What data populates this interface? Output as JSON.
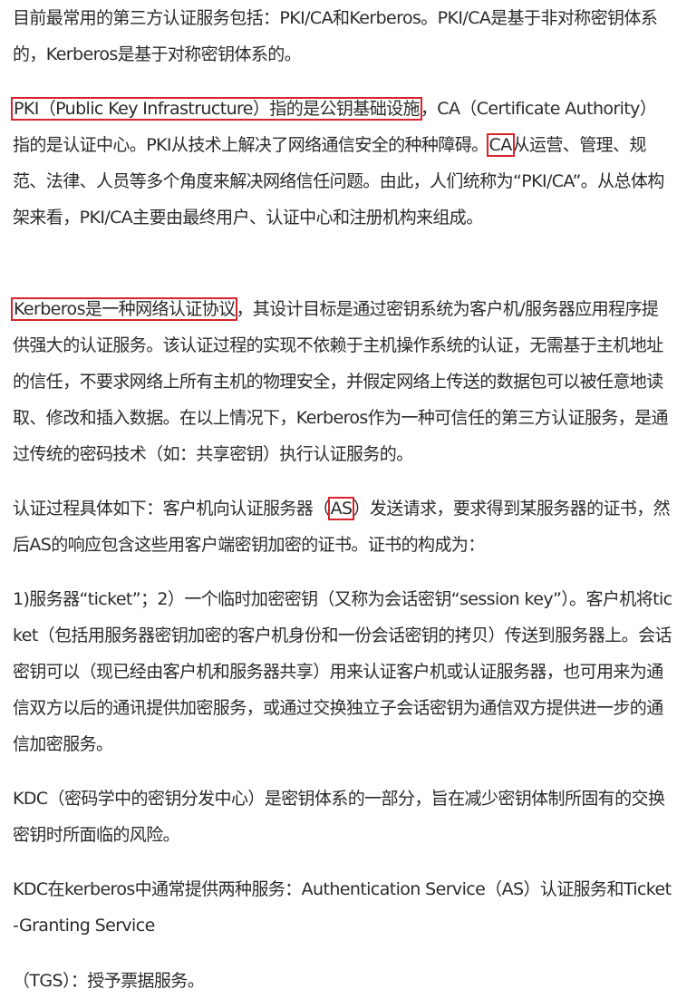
{
  "article": {
    "p1": "目前最常用的第三方认证服务包括：PKI/CA和Kerberos。PKI/CA是基于非对称密钥体系的，Kerberos是基于对称密钥体系的。",
    "p2": {
      "hl1": "PKI（Public Key Infrastructure）指的是公钥基础设施",
      "t1": "，CA（Certificate Authority）指的是认证中心。PKI从技术上解决了网络通信安全的种种障碍。",
      "hl2": "CA",
      "t2": "从运营、管理、规范、法律、人员等多个角度来解决网络信任问题。由此，人们统称为“PKI/CA”。从总体构架来看，PKI/CA主要由最终用户、认证中心和注册机构来组成。"
    },
    "p3": {
      "hl": "Kerberos是一种网络认证协议",
      "t": "，其设计目标是通过密钥系统为客户机/服务器应用程序提供强大的认证服务。该认证过程的实现不依赖于主机操作系统的认证，无需基于主机地址的信任，不要求网络上所有主机的物理安全，并假定网络上传送的数据包可以被任意地读取、修改和插入数据。在以上情况下，Kerberos作为一种可信任的第三方认证服务，是通过传统的密码技术（如：共享密钥）执行认证服务的。"
    },
    "p4": {
      "t1": "认证过程具体如下：客户机向认证服务器（",
      "hl": "AS",
      "t2": "）发送请求，要求得到某服务器的证书，然后AS的响应包含这些用客户端密钥加密的证书。证书的构成为："
    },
    "p5": "1)服务器“ticket”；2）一个临时加密密钥（又称为会话密钥“session key”）。客户机将ticket（包括用服务器密钥加密的客户机身份和一份会话密钥的拷贝）传送到服务器上。会话密钥可以（现已经由客户机和服务器共享）用来认证客户机或认证服务器，也可用来为通信双方以后的通讯提供加密服务，或通过交换独立子会话密钥为通信双方提供进一步的通信加密服务。",
    "p6": "KDC（密码学中的密钥分发中心）是密钥体系的一部分，旨在减少密钥体制所固有的交换密钥时所面临的风险。",
    "p7": "KDC在kerberos中通常提供两种服务：Authentication Service（AS）认证服务和Ticket-Granting Service",
    "p8": "（TGS）：授予票据服务。"
  },
  "colors": {
    "text": "#2b2b2b",
    "highlight_border": "#d8242d",
    "background": "#ffffff"
  }
}
